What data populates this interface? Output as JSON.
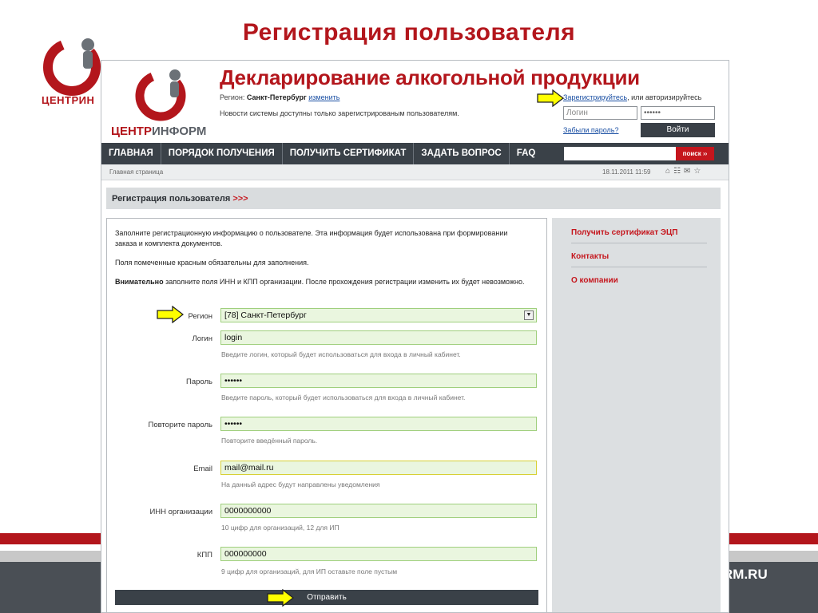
{
  "slide": {
    "title": "Регистрация пользователя",
    "logo_text": "ЦЕНТРИН",
    "footer_url": "RM.RU"
  },
  "header": {
    "logo_text_main": "ЦЕНТР",
    "logo_text_sub": "ИНФОРМ",
    "site_title": "Декларирование алкогольной продукции",
    "region_label": "Регион:",
    "region_value": "Санкт-Петербург",
    "region_change": "изменить",
    "notice": "Новости системы доступны только зарегистрированым пользователям.",
    "register_link": "Зарегистрируйтесь",
    "auth_text": ", или авторизируйтесь",
    "login_placeholder": "Логин",
    "password_mask": "••••••",
    "forgot_link": "Забыли пароль?",
    "login_button": "Войти"
  },
  "nav": {
    "items": [
      "ГЛАВНАЯ",
      "ПОРЯДОК ПОЛУЧЕНИЯ",
      "ПОЛУЧИТЬ СЕРТИФИКАТ",
      "ЗАДАТЬ ВОПРОС",
      "FAQ"
    ],
    "search_button": "поиск ››"
  },
  "crumbs": {
    "path": "Главная страница",
    "date": "18.11.2011 11:59",
    "icons": [
      "home-icon",
      "sitemap-icon",
      "mail-icon",
      "star-icon"
    ]
  },
  "section": {
    "title": "Регистрация пользователя",
    "marker": ">>>"
  },
  "form": {
    "intro1": "Заполните регистрационную информацию о пользователе. Эта информация будет использована при формировании заказа и комплекта документов.",
    "intro2": "Поля помеченные красным обязательны для заполнения.",
    "intro3_bold": "Внимательно",
    "intro3_rest": " заполните поля ИНН и КПП организации. После прохождения регистрации изменить их будет невозможно.",
    "region": {
      "label": "Регион",
      "value": "[78] Санкт-Петербург"
    },
    "login": {
      "label": "Логин",
      "value": "login",
      "hint": "Введите логин, который будет использоваться для входа в личный кабинет."
    },
    "password": {
      "label": "Пароль",
      "value": "••••••",
      "hint": "Введите пароль, который будет использоваться для входа в личный кабинет."
    },
    "password2": {
      "label": "Повторите пароль",
      "value": "••••••",
      "hint": "Повторите введённый пароль."
    },
    "email": {
      "label": "Email",
      "value": "mail@mail.ru",
      "hint": "На данный адрес будут направлены уведомления"
    },
    "inn": {
      "label": "ИНН организации",
      "value": "0000000000",
      "hint": "10 цифр для организаций, 12 для ИП"
    },
    "kpp": {
      "label": "КПП",
      "value": "000000000",
      "hint": "9 цифр для организаций, для ИП оставьте поле пустым"
    },
    "submit": "Отправить"
  },
  "sidebar": {
    "items": [
      "Получить сертификат ЭЦП",
      "Контакты",
      "О компании"
    ]
  },
  "colors": {
    "brand_red": "#b3161c",
    "nav_dark": "#3a4148",
    "field_green": "#eaf6df",
    "arrow_yellow": "#ffff00"
  }
}
